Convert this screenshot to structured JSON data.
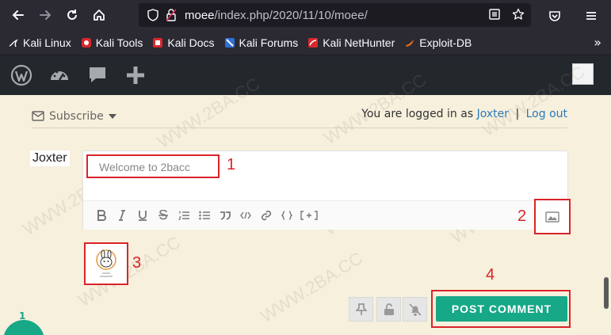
{
  "browser": {
    "url_host": "moee",
    "url_path": "/index.php/2020/11/10/moee/",
    "bookmarks": [
      {
        "label": "Kali Linux",
        "icon": "kali-dragon-icon"
      },
      {
        "label": "Kali Tools",
        "icon": "kali-tools-icon"
      },
      {
        "label": "Kali Docs",
        "icon": "kali-docs-icon"
      },
      {
        "label": "Kali Forums",
        "icon": "kali-forums-icon"
      },
      {
        "label": "Kali NetHunter",
        "icon": "kali-nethunter-icon"
      },
      {
        "label": "Exploit-DB",
        "icon": "exploit-db-icon"
      }
    ],
    "more_label": "»"
  },
  "comments": {
    "subscribe_label": "Subscribe",
    "logged_in_prefix": "You are logged in as",
    "user_name": "Joxter",
    "separator": "|",
    "logout_label": "Log out",
    "author_label": "Joxter",
    "input_value": "Welcome to 2bacc",
    "post_button": "POST COMMENT"
  },
  "annotations": {
    "a1": "1",
    "a2": "2",
    "a3": "3",
    "a4": "4"
  },
  "notification_count": "1",
  "watermark_text": "WWW.2BA.CC",
  "colors": {
    "chrome": "#2b2a33",
    "wp_bar": "#23282d",
    "page_bg": "#f6f0dc",
    "accent_green": "#17a887",
    "annotation_red": "#d9232a",
    "link_blue": "#2a7ab8"
  }
}
